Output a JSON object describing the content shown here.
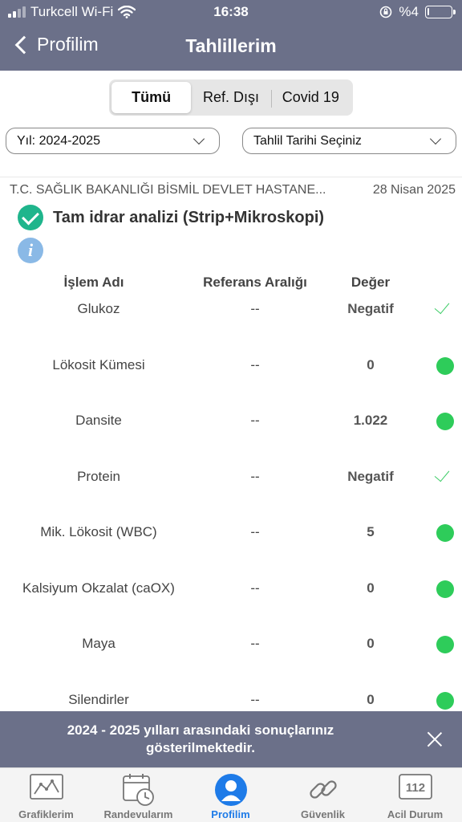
{
  "status_bar": {
    "carrier": "Turkcell Wi-Fi",
    "time": "16:38",
    "battery_text": "%4",
    "battery_level_percent": 4
  },
  "nav": {
    "back_label": "Profilim",
    "title": "Tahlillerim"
  },
  "segments": [
    {
      "label": "Tümü",
      "active": true
    },
    {
      "label": "Ref. Dışı",
      "active": false
    },
    {
      "label": "Covid 19",
      "active": false
    }
  ],
  "filters": {
    "year": "Yıl: 2024-2025",
    "date": "Tahlil Tarihi Seçiniz"
  },
  "record": {
    "hospital": "T.C. SAĞLIK BAKANLIĞI BİSMİL DEVLET HASTANE...",
    "date": "28 Nisan 2025",
    "test_name": "Tam idrar analizi (Strip+Mikroskopi)",
    "info_glyph": "i"
  },
  "table": {
    "headers": {
      "name": "İşlem Adı",
      "reference": "Referans Aralığı",
      "value": "Değer"
    },
    "rows": [
      {
        "name": "Glukoz",
        "reference": "--",
        "value": "Negatif",
        "status": "check"
      },
      {
        "name": "Lökosit Kümesi",
        "reference": "--",
        "value": "0",
        "status": "dot"
      },
      {
        "name": "Dansite",
        "reference": "--",
        "value": "1.022",
        "status": "dot"
      },
      {
        "name": "Protein",
        "reference": "--",
        "value": "Negatif",
        "status": "check"
      },
      {
        "name": "Mik. Lökosit (WBC)",
        "reference": "--",
        "value": "5",
        "status": "dot"
      },
      {
        "name": "Kalsiyum Okzalat (caOX)",
        "reference": "--",
        "value": "0",
        "status": "dot"
      },
      {
        "name": "Maya",
        "reference": "--",
        "value": "0",
        "status": "dot"
      },
      {
        "name": "Silendirler",
        "reference": "--",
        "value": "0",
        "status": "dot"
      }
    ]
  },
  "banner": {
    "text": "2024 - 2025 yılları arasındaki sonuçlarınız gösterilmektedir."
  },
  "tabbar": [
    {
      "label": "Grafiklerim",
      "icon": "chart-icon",
      "active": false
    },
    {
      "label": "Randevularım",
      "icon": "calendar-clock-icon",
      "active": false
    },
    {
      "label": "Profilim",
      "icon": "profile-icon",
      "active": true
    },
    {
      "label": "Güvenlik",
      "icon": "link-icon",
      "active": false
    },
    {
      "label": "Acil Durum",
      "icon": "emergency-112-icon",
      "active": false
    }
  ],
  "emergency_number": "112",
  "colors": {
    "header": "#6b7089",
    "accent": "#1e7be8",
    "ok_green": "#2ecc5a",
    "check_teal": "#1fb58c",
    "info_blue": "#8ab9e6"
  }
}
